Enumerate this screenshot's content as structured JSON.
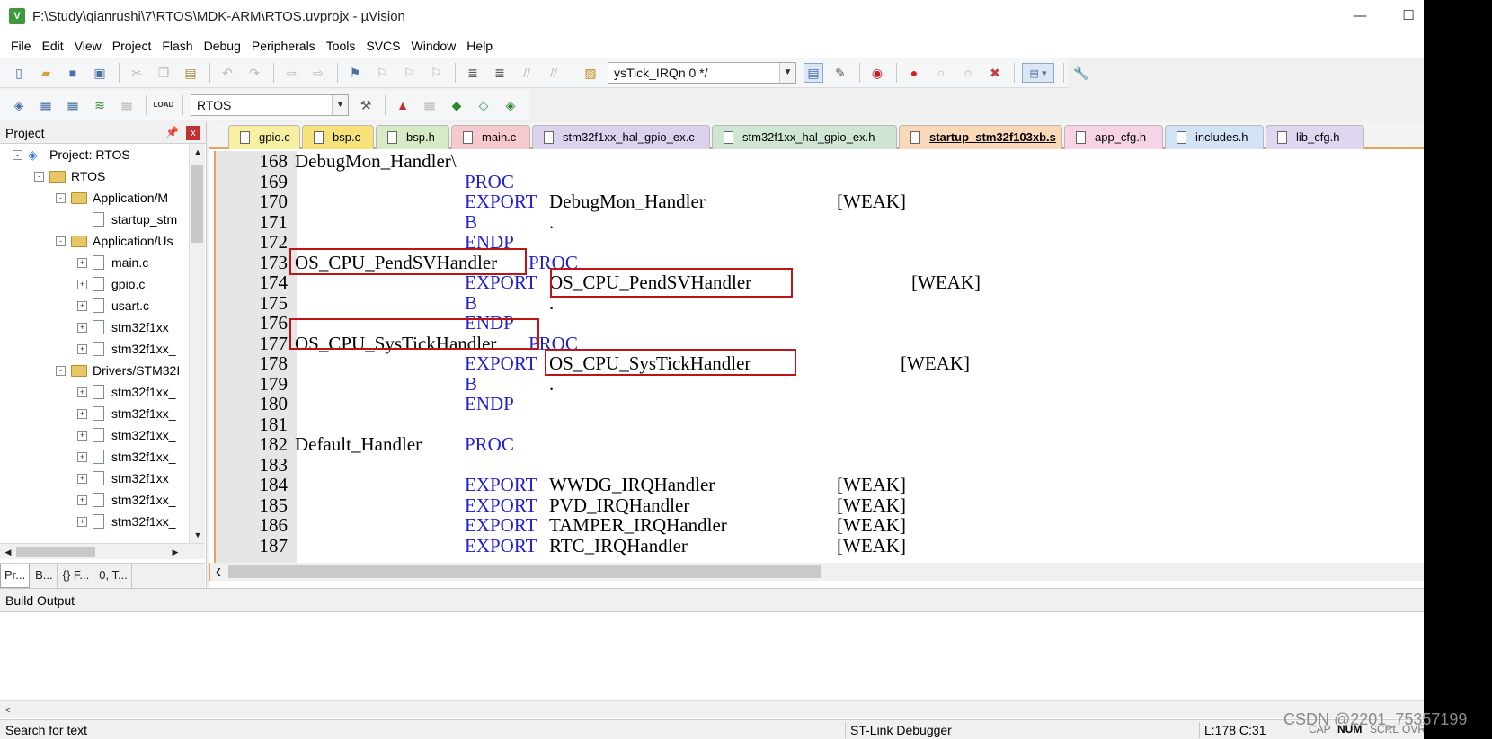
{
  "window": {
    "title": "F:\\Study\\qianrushi\\7\\RTOS\\MDK-ARM\\RTOS.uvprojx - µVision",
    "app_icon": "V",
    "minimize_glyph": "—",
    "maximize_glyph": "☐"
  },
  "menu": [
    "File",
    "Edit",
    "View",
    "Project",
    "Flash",
    "Debug",
    "Peripherals",
    "Tools",
    "SVCS",
    "Window",
    "Help"
  ],
  "toolbar1": {
    "find_combo_value": "ysTick_IRQn 0 */"
  },
  "toolbar2": {
    "load_label": "LOAD",
    "target_combo_value": "RTOS"
  },
  "project_panel": {
    "title": "Project",
    "pin_glyph": "📌",
    "close_glyph": "x",
    "tree": [
      {
        "label": "Project: RTOS",
        "type": "project",
        "expander": "-"
      },
      {
        "label": "RTOS",
        "type": "target",
        "expander": "-"
      },
      {
        "label": "Application/M",
        "type": "folder",
        "expander": "-"
      },
      {
        "label": "startup_stm",
        "type": "file",
        "expander": ""
      },
      {
        "label": "Application/Us",
        "type": "folder",
        "expander": "-"
      },
      {
        "label": "main.c",
        "type": "file",
        "expander": "+"
      },
      {
        "label": "gpio.c",
        "type": "file",
        "expander": "+"
      },
      {
        "label": "usart.c",
        "type": "file",
        "expander": "+"
      },
      {
        "label": "stm32f1xx_",
        "type": "file",
        "expander": "+"
      },
      {
        "label": "stm32f1xx_",
        "type": "file",
        "expander": "+"
      },
      {
        "label": "Drivers/STM32I",
        "type": "folder",
        "expander": "-"
      },
      {
        "label": "stm32f1xx_",
        "type": "file",
        "expander": "+"
      },
      {
        "label": "stm32f1xx_",
        "type": "file",
        "expander": "+"
      },
      {
        "label": "stm32f1xx_",
        "type": "file",
        "expander": "+"
      },
      {
        "label": "stm32f1xx_",
        "type": "file",
        "expander": "+"
      },
      {
        "label": "stm32f1xx_",
        "type": "file",
        "expander": "+"
      },
      {
        "label": "stm32f1xx_",
        "type": "file",
        "expander": "+"
      },
      {
        "label": "stm32f1xx_",
        "type": "file",
        "expander": "+"
      }
    ],
    "tabs": [
      "Pr...",
      "B...",
      "{} F...",
      "0, T..."
    ]
  },
  "editor": {
    "tabs": [
      {
        "label": "gpio.c",
        "color": "#f7f0a0",
        "active": false
      },
      {
        "label": "bsp.c",
        "color": "#f7e27a",
        "active": false
      },
      {
        "label": "bsp.h",
        "color": "#d6ebc5",
        "active": false
      },
      {
        "label": "main.c",
        "color": "#f6c9cf",
        "active": false
      },
      {
        "label": "stm32f1xx_hal_gpio_ex.c",
        "color": "#dcd2ee",
        "active": false
      },
      {
        "label": "stm32f1xx_hal_gpio_ex.h",
        "color": "#cfe6d4",
        "active": false
      },
      {
        "label": "startup_stm32f103xb.s",
        "color": "#fbd9b8",
        "active": true
      },
      {
        "label": "app_cfg.h",
        "color": "#f6d4e6",
        "active": false
      },
      {
        "label": "includes.h",
        "color": "#d2e3f5",
        "active": false
      },
      {
        "label": "lib_cfg.h",
        "color": "#e0d6f0",
        "active": false
      }
    ],
    "lines": [
      {
        "num": "168",
        "label": "DebugMon_Handler\\",
        "op": "",
        "arg": "",
        "attr": ""
      },
      {
        "num": "169",
        "label": "",
        "op": "PROC",
        "arg": "",
        "attr": ""
      },
      {
        "num": "170",
        "label": "",
        "op": "EXPORT",
        "arg": "DebugMon_Handler",
        "attr": "[WEAK]"
      },
      {
        "num": "171",
        "label": "",
        "op": "B",
        "arg": ".",
        "attr": ""
      },
      {
        "num": "172",
        "label": "",
        "op": "ENDP",
        "arg": "",
        "attr": ""
      },
      {
        "num": "173",
        "label": "OS_CPU_PendSVHandler",
        "op": "PROC",
        "arg": "",
        "attr": ""
      },
      {
        "num": "174",
        "label": "",
        "op": "EXPORT",
        "arg": "OS_CPU_PendSVHandler",
        "attr": "[WEAK]"
      },
      {
        "num": "175",
        "label": "",
        "op": "B",
        "arg": ".",
        "attr": ""
      },
      {
        "num": "176",
        "label": "",
        "op": "ENDP",
        "arg": "",
        "attr": ""
      },
      {
        "num": "177",
        "label": "OS_CPU_SysTickHandler",
        "op": "PROC",
        "arg": "",
        "attr": ""
      },
      {
        "num": "178",
        "label": "",
        "op": "EXPORT",
        "arg": "OS_CPU_SysTickHandler",
        "attr": "[WEAK]"
      },
      {
        "num": "179",
        "label": "",
        "op": "B",
        "arg": ".",
        "attr": ""
      },
      {
        "num": "180",
        "label": "",
        "op": "ENDP",
        "arg": "",
        "attr": ""
      },
      {
        "num": "181",
        "label": "",
        "op": "",
        "arg": "",
        "attr": ""
      },
      {
        "num": "182",
        "label": "Default_Handler",
        "op": "PROC",
        "arg": "",
        "attr": ""
      },
      {
        "num": "183",
        "label": "",
        "op": "",
        "arg": "",
        "attr": ""
      },
      {
        "num": "184",
        "label": "",
        "op": "EXPORT",
        "arg": "WWDG_IRQHandler",
        "attr": "[WEAK]"
      },
      {
        "num": "185",
        "label": "",
        "op": "EXPORT",
        "arg": "PVD_IRQHandler",
        "attr": "[WEAK]"
      },
      {
        "num": "186",
        "label": "",
        "op": "EXPORT",
        "arg": "TAMPER_IRQHandler",
        "attr": "[WEAK]"
      },
      {
        "num": "187",
        "label": "",
        "op": "EXPORT",
        "arg": "RTC_IRQHandler",
        "attr": "[WEAK]"
      }
    ]
  },
  "build_output": {
    "title": "Build Output",
    "scroll_left_glyph": "<"
  },
  "statusbar": {
    "search_hint": "Search for text",
    "debugger": "ST-Link Debugger",
    "cursor": "L:178 C:31",
    "cap": "CAP",
    "num": "NUM",
    "scrl": "SCRL",
    "ovr": "OVR"
  },
  "watermark": "CSDN @2201_75357199"
}
